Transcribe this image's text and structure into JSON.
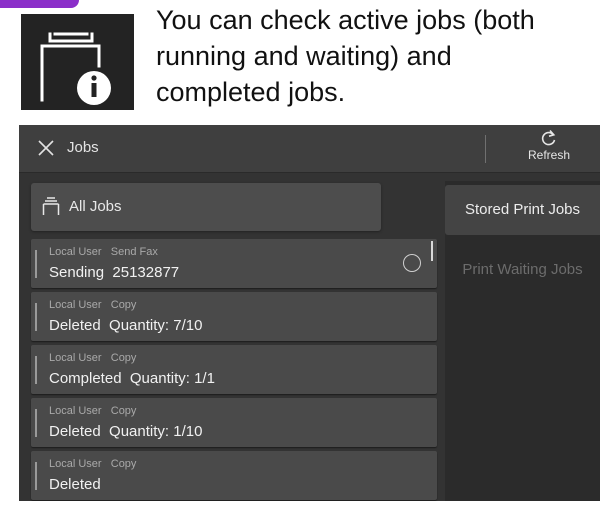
{
  "caption": {
    "lines": [
      "You can check active jobs (both",
      "running and waiting) and",
      "completed jobs."
    ]
  },
  "header": {
    "title": "Jobs",
    "refresh_label": "Refresh"
  },
  "all_jobs_label": "All Jobs",
  "side_tabs": {
    "stored": "Stored Print Jobs",
    "waiting": "Print Waiting Jobs"
  },
  "jobs": [
    {
      "meta": "Local User   Send Fax",
      "status": "Sending  25132877",
      "in_progress": true
    },
    {
      "meta": "Local User   Copy",
      "status": "Deleted  Quantity: 7/10"
    },
    {
      "meta": "Local User   Copy",
      "status": "Completed  Quantity: 1/1"
    },
    {
      "meta": "Local User   Copy",
      "status": "Deleted  Quantity: 1/10"
    },
    {
      "meta": "Local User   Copy",
      "status": "Deleted"
    }
  ],
  "colors": {
    "accent": "#8b2fc9",
    "panel": "#333333",
    "row": "#4a4a4a"
  }
}
